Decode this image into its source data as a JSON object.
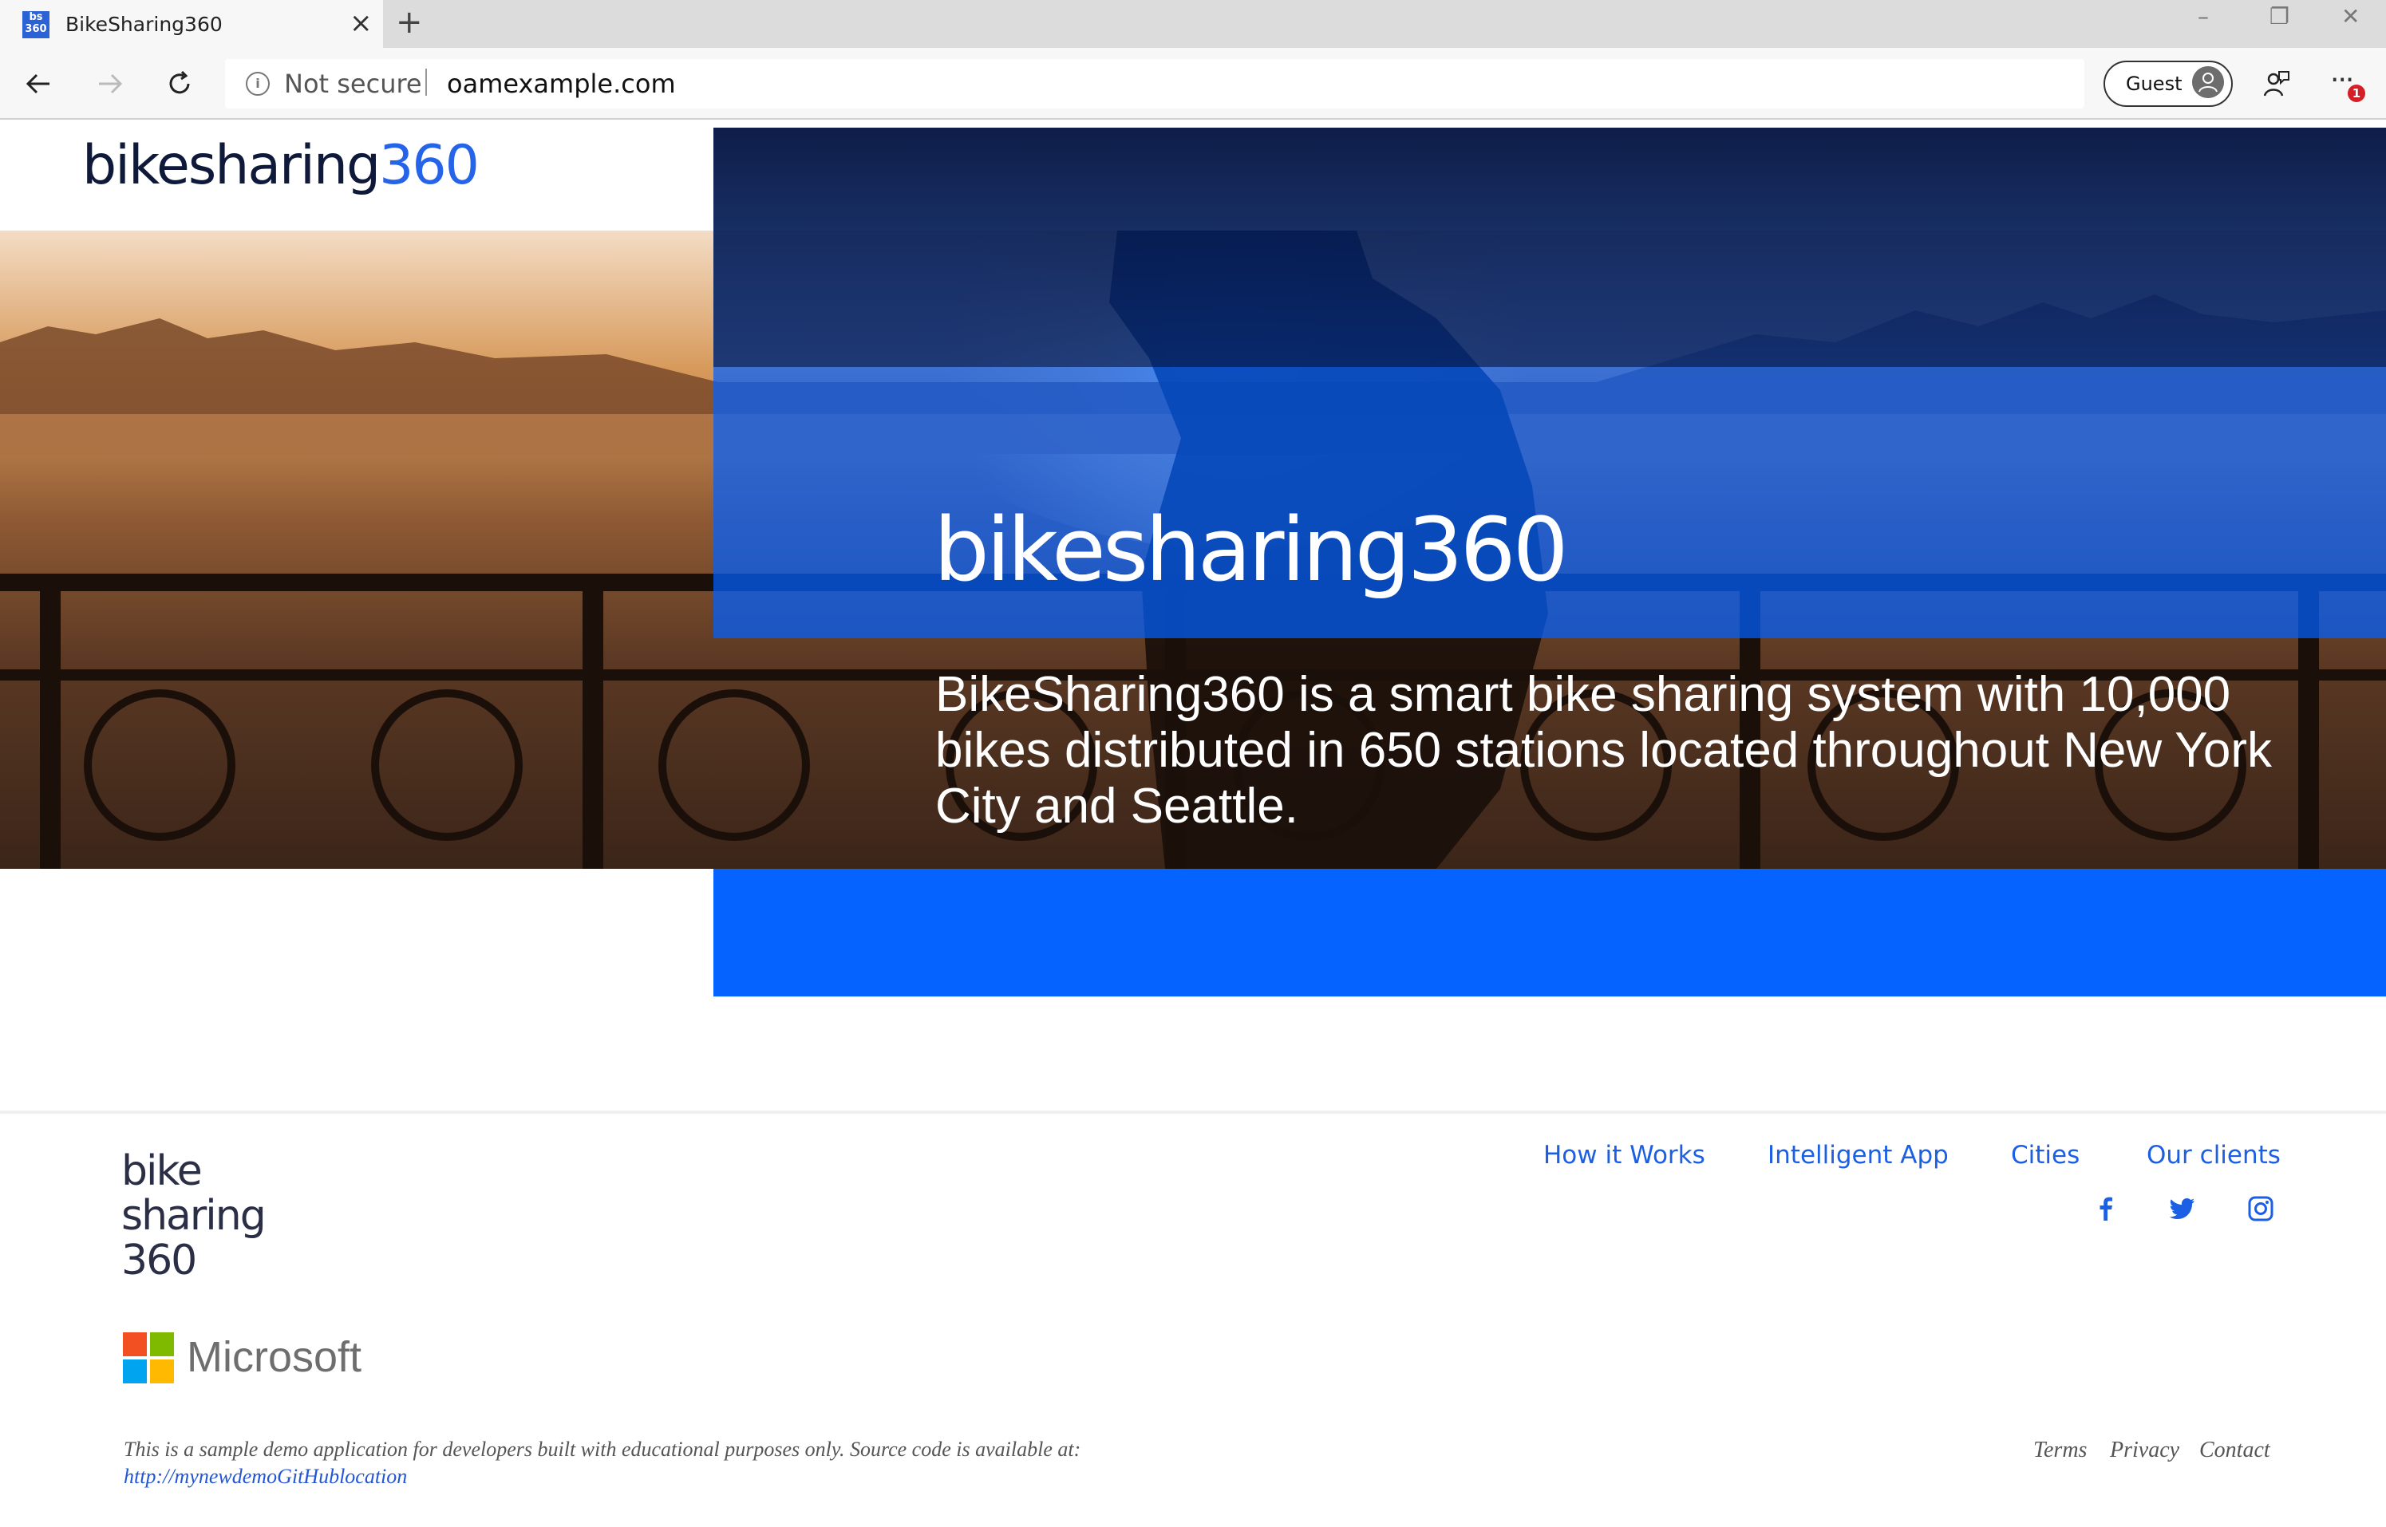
{
  "browser": {
    "tab_title": "BikeSharing360",
    "favicon_text": "bs 360",
    "address": {
      "security_label": "Not secure",
      "url": "oamexample.com"
    },
    "profile_label": "Guest",
    "notification_count": "1"
  },
  "header": {
    "logo_text": "bikesharing",
    "logo_number": "360"
  },
  "hero": {
    "logo_text": "bikesharing360",
    "description": "BikeSharing360 is a smart bike sharing system with 10,000 bikes distributed in 650 stations located throughout New York City and Seattle."
  },
  "footer": {
    "logo_lines": [
      "bike",
      "sharing",
      "360"
    ],
    "nav": [
      "How it Works",
      "Intelligent App",
      "Cities",
      "Our clients"
    ],
    "social": [
      "facebook-icon",
      "twitter-icon",
      "instagram-icon"
    ],
    "partner": "Microsoft",
    "disclaimer": "This is a sample demo application for developers built with educational purposes only. Source code is available at:",
    "source_link": "http://mynewdemoGitHublocation",
    "legal": [
      "Terms",
      "Privacy",
      "Contact"
    ]
  },
  "colors": {
    "brand_blue": "#0564ff",
    "link_blue": "#1b5fe5",
    "logo_dark": "#0f1a3a"
  }
}
